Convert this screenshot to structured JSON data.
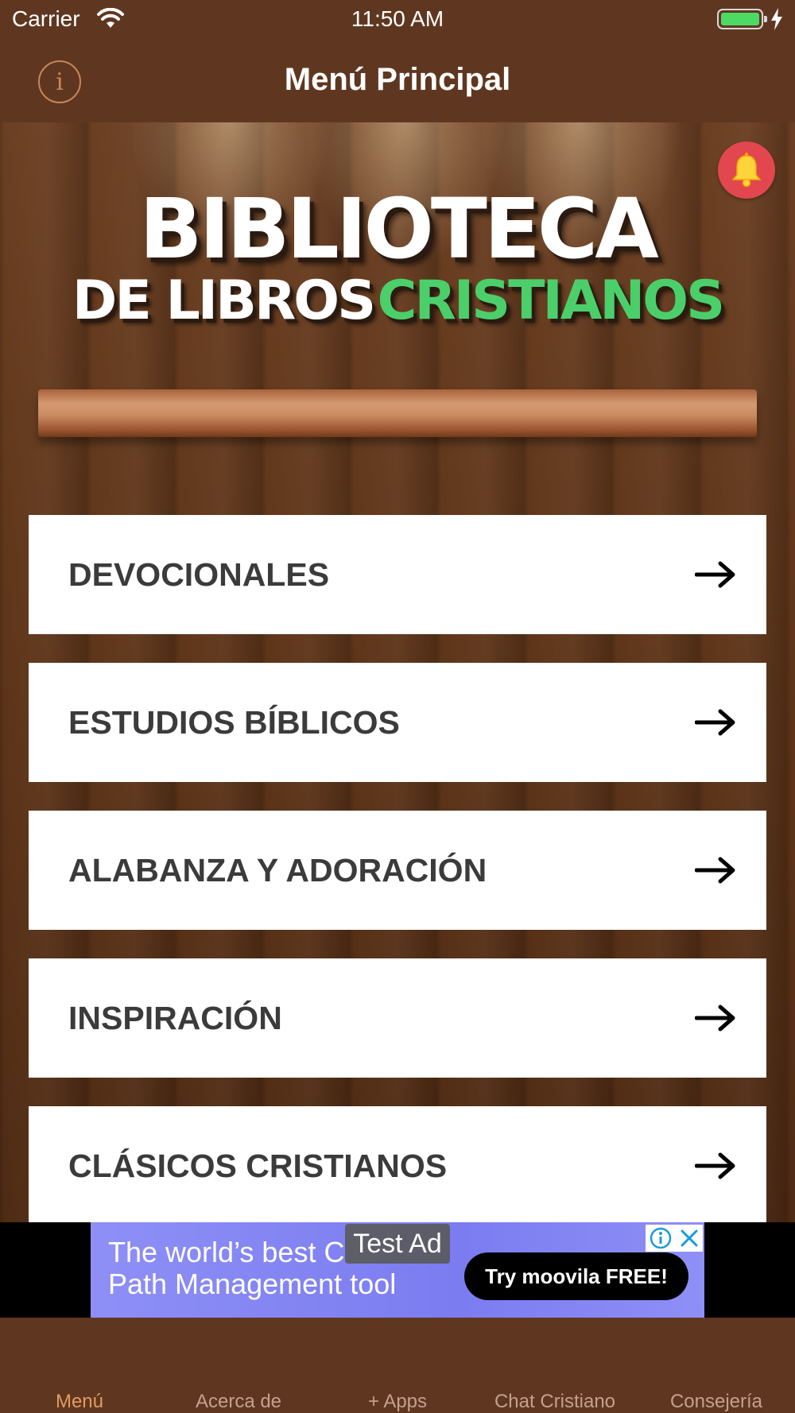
{
  "status_bar": {
    "carrier": "Carrier",
    "time": "11:50 AM"
  },
  "nav": {
    "title": "Menú Principal",
    "info_icon": "info-icon"
  },
  "logo": {
    "line1": "BIBLIOTECA",
    "line2_white": "DE LIBROS",
    "line2_green": "CRISTIANOS",
    "green_color": "#4bcf6b"
  },
  "menu": {
    "items": [
      {
        "label": "DEVOCIONALES"
      },
      {
        "label": "ESTUDIOS BÍBLICOS"
      },
      {
        "label": "ALABANZA Y ADORACIÓN"
      },
      {
        "label": "INSPIRACIÓN"
      },
      {
        "label": "CLÁSICOS CRISTIANOS"
      }
    ]
  },
  "ad": {
    "label": "Test Ad",
    "headline": "The world's best C...",
    "headline_line1": "The world’s best C",
    "headline_line2": "Path Management tool",
    "cta": "Try moovila FREE!"
  },
  "tabs": [
    {
      "label": "Menú",
      "active": true
    },
    {
      "label": "Acerca de",
      "active": false
    },
    {
      "label": "+ Apps",
      "active": false
    },
    {
      "label": "Chat Cristiano",
      "active": false
    },
    {
      "label": "Consejería",
      "active": false
    }
  ],
  "colors": {
    "nav_background": "#5f3720",
    "bell_background": "#e2474f",
    "ad_background": "#8e8ff6",
    "tab_active": "#e39a60"
  }
}
